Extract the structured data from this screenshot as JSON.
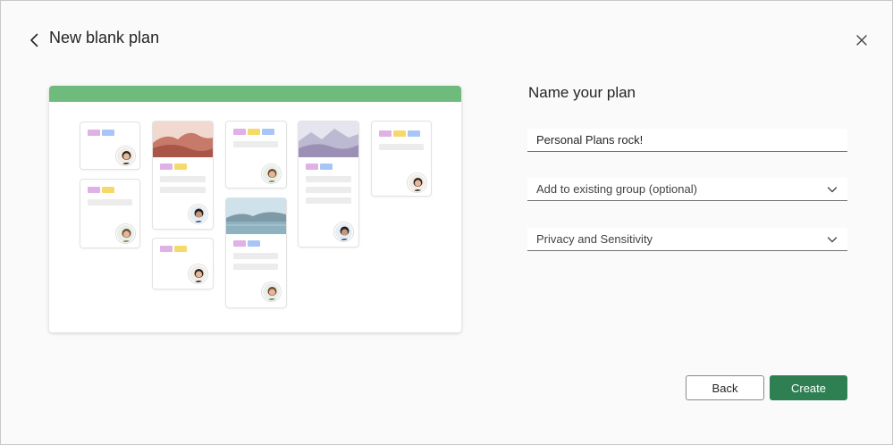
{
  "dialog": {
    "title": "New blank plan",
    "back_icon": "chevron-left-icon",
    "close_icon": "close-icon"
  },
  "form": {
    "heading": "Name your plan",
    "plan_name_value": "Personal Plans rock!",
    "group_select_label": "Add to existing group (optional)",
    "privacy_select_label": "Privacy and Sensitivity"
  },
  "buttons": {
    "back_label": "Back",
    "create_label": "Create"
  },
  "colors": {
    "accent_green": "#2e8052",
    "preview_header": "#6fbb7d"
  }
}
